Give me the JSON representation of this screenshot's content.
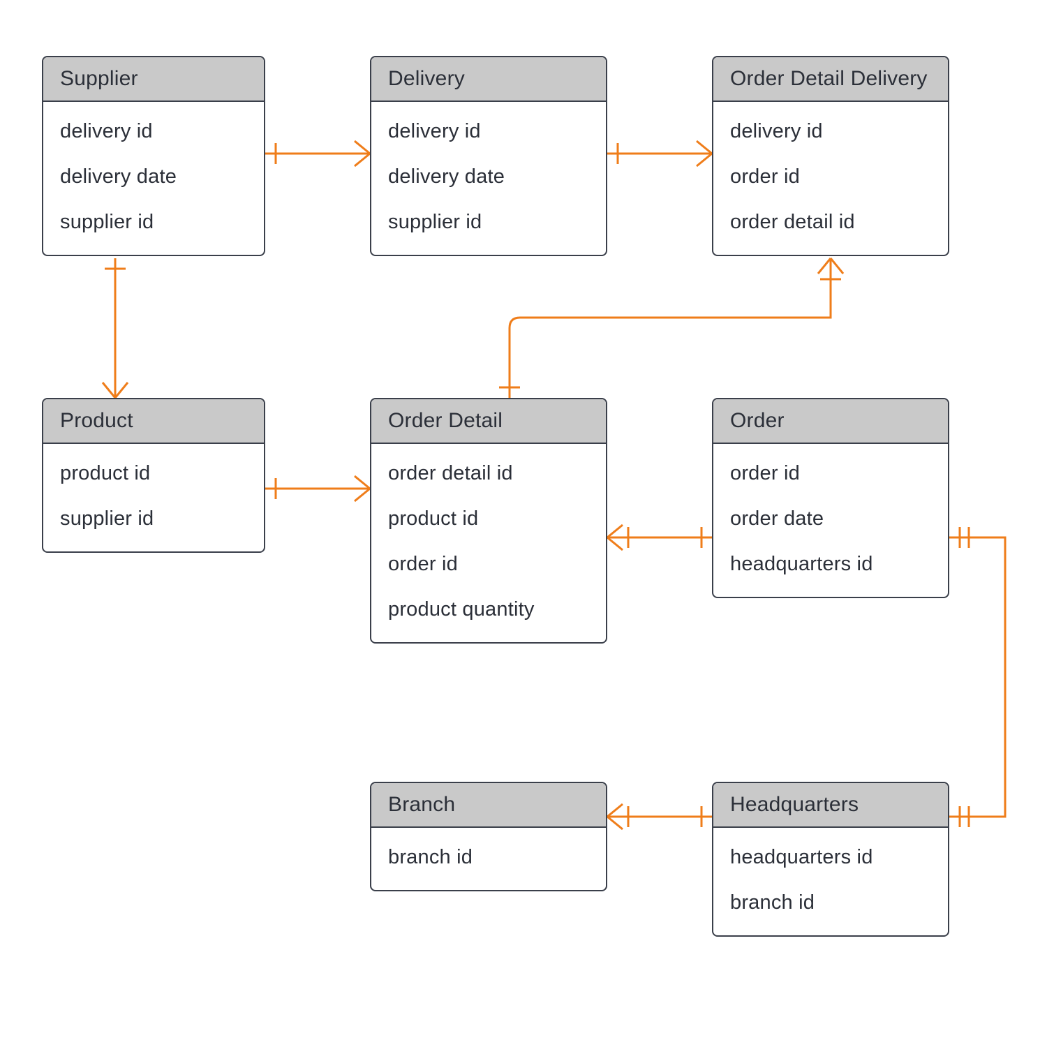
{
  "colors": {
    "line": "#ef7d1a",
    "border": "#3a3f4a",
    "header": "#c9c9c9"
  },
  "entities": {
    "supplier": {
      "title": "Supplier",
      "attrs": [
        "delivery id",
        "delivery date",
        "supplier id"
      ]
    },
    "delivery": {
      "title": "Delivery",
      "attrs": [
        "delivery id",
        "delivery date",
        "supplier id"
      ]
    },
    "order_detail_delivery": {
      "title": "Order Detail Delivery",
      "attrs": [
        "delivery id",
        "order id",
        "order detail id"
      ]
    },
    "product": {
      "title": "Product",
      "attrs": [
        "product id",
        "supplier id"
      ]
    },
    "order_detail": {
      "title": "Order Detail",
      "attrs": [
        "order detail id",
        "product id",
        "order id",
        "product quantity"
      ]
    },
    "order": {
      "title": "Order",
      "attrs": [
        "order id",
        "order date",
        "headquarters id"
      ]
    },
    "branch": {
      "title": "Branch",
      "attrs": [
        "branch id"
      ]
    },
    "headquarters": {
      "title": "Headquarters",
      "attrs": [
        "headquarters id",
        "branch id"
      ]
    }
  },
  "relationships": [
    {
      "from": "supplier",
      "to": "delivery",
      "type": "one-to-many"
    },
    {
      "from": "delivery",
      "to": "order_detail_delivery",
      "type": "one-to-many"
    },
    {
      "from": "supplier",
      "to": "product",
      "type": "one-to-many"
    },
    {
      "from": "product",
      "to": "order_detail",
      "type": "one-to-many"
    },
    {
      "from": "order_detail",
      "to": "order_detail_delivery",
      "type": "one-to-many"
    },
    {
      "from": "order",
      "to": "order_detail",
      "type": "one-to-many"
    },
    {
      "from": "headquarters",
      "to": "order",
      "type": "one-to-one"
    },
    {
      "from": "headquarters",
      "to": "branch",
      "type": "one-to-many"
    }
  ]
}
